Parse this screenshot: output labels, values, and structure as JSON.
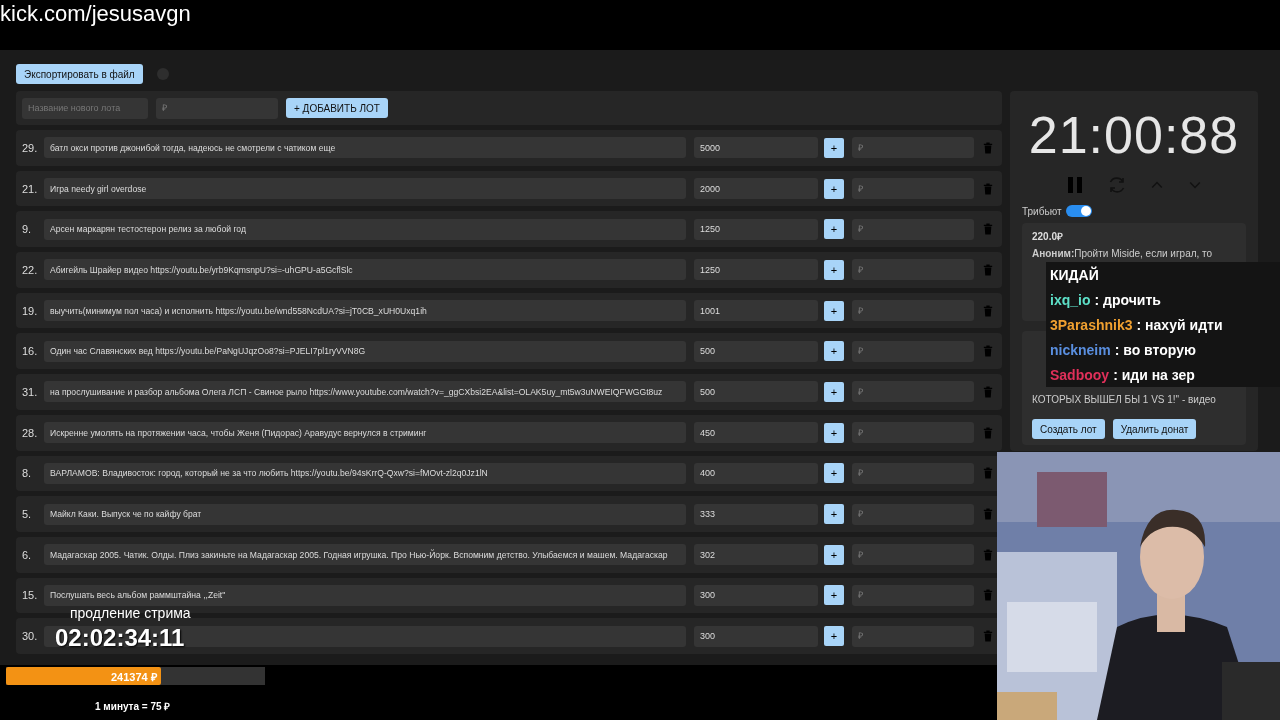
{
  "url_bar": {
    "text": "kick.com/jesusavgn"
  },
  "export_button": "Экспортировать в файл",
  "add_lot": {
    "name_placeholder": "Название нового лота",
    "price_placeholder": "₽",
    "button": "+ ДОБАВИТЬ ЛОТ"
  },
  "lots": [
    {
      "number": "29.",
      "text": "батл окси против джонибой тогда, надеюсь не смотрели с чатиком еще",
      "amount": "5000",
      "add": "+",
      "placeholder": "₽"
    },
    {
      "number": "21.",
      "text": "Игра needy girl overdose",
      "amount": "2000",
      "add": "+",
      "placeholder": "₽"
    },
    {
      "number": "9.",
      "text": "Арсен маркарян тестостерон релиз за любой год",
      "amount": "1250",
      "add": "+",
      "placeholder": "₽"
    },
    {
      "number": "22.",
      "text": "Абигейль Шрайер видео https://youtu.be/yrb9KqmsnpU?si=-uhGPU-a5GcflSlc",
      "amount": "1250",
      "add": "+",
      "placeholder": "₽"
    },
    {
      "number": "19.",
      "text": "выучить(минимум пол часа) и исполнить https://youtu.be/wnd558NcdUA?si=jT0CB_xUH0Uxq1ih",
      "amount": "1001",
      "add": "+",
      "placeholder": "₽"
    },
    {
      "number": "16.",
      "text": "Один час Славянских вед https://youtu.be/PaNgUJqzOo8?si=PJELI7pl1ryVVN8G",
      "amount": "500",
      "add": "+",
      "placeholder": "₽"
    },
    {
      "number": "31.",
      "text": "на прослушивание и разбор альбома Олега ЛСП - Свиное рыло https://www.youtube.com/watch?v=_ggCXbsi2EA&list=OLAK5uy_mt5w3uNWEIQFWGGt8uz",
      "amount": "500",
      "add": "+",
      "placeholder": "₽"
    },
    {
      "number": "28.",
      "text": "Искренне умолять на протяжении часа, чтобы Женя (Пидорас) Аравудус вернулся в стриминг",
      "amount": "450",
      "add": "+",
      "placeholder": "₽"
    },
    {
      "number": "8.",
      "text": "ВАРЛАМОВ: Владивосток: город, который не за что любить https://youtu.be/94sKrrQ-Qxw?si=fMOvt-zl2q0Jz1lN",
      "amount": "400",
      "add": "+",
      "placeholder": "₽"
    },
    {
      "number": "5.",
      "text": "Майкл Каки. Выпуск че по кайфу брат",
      "amount": "333",
      "add": "+",
      "placeholder": "₽"
    },
    {
      "number": "6.",
      "text": "Мадагаскар 2005. Чатик. Олды. Плиз закиньте на Мадагаскар 2005. Годная игрушка. Про Нью-Йорк. Вспомним детство. Улыбаемся и машем. Мадагаскар",
      "amount": "302",
      "add": "+",
      "placeholder": "₽"
    },
    {
      "number": "15.",
      "text": "Послушать весь альбом раммштайна ,,Zeit\"",
      "amount": "300",
      "add": "+",
      "placeholder": "₽"
    },
    {
      "number": "30.",
      "amount": "300",
      "add": "+",
      "placeholder": "₽"
    }
  ],
  "timer": {
    "time": "21:00:88",
    "tribute_label": "Трибьют",
    "tribute_on": true
  },
  "donations": [
    {
      "amount": "220.0₽",
      "author": "Аноним:",
      "text": "Пройти Miside, если играл, то"
    },
    {
      "text": "КОТОРЫХ ВЫШЕЛ БЫ 1 VS 1!\" - видео",
      "buttons": [
        "Создать лот",
        "Удалить донат"
      ]
    }
  ],
  "chat": [
    {
      "message": "КИДАЙ"
    },
    {
      "user": "ixq_io",
      "color": "#5de0c8",
      "message": ": дрочить"
    },
    {
      "user": "3Parashnik3",
      "color": "#f0a030",
      "message": ": нахуй идти"
    },
    {
      "user": "nickneim",
      "color": "#5a8fe0",
      "message": ": во вторую"
    },
    {
      "user": "Sadbooy",
      "color": "#e0305a",
      "message": ": иди на зер"
    }
  ],
  "stream_overlay": {
    "caption": "продление стрима",
    "countdown": "02:02:34:11",
    "total": "241374 ₽",
    "level": 0.6,
    "rate": "1 минута = 75 ₽"
  }
}
